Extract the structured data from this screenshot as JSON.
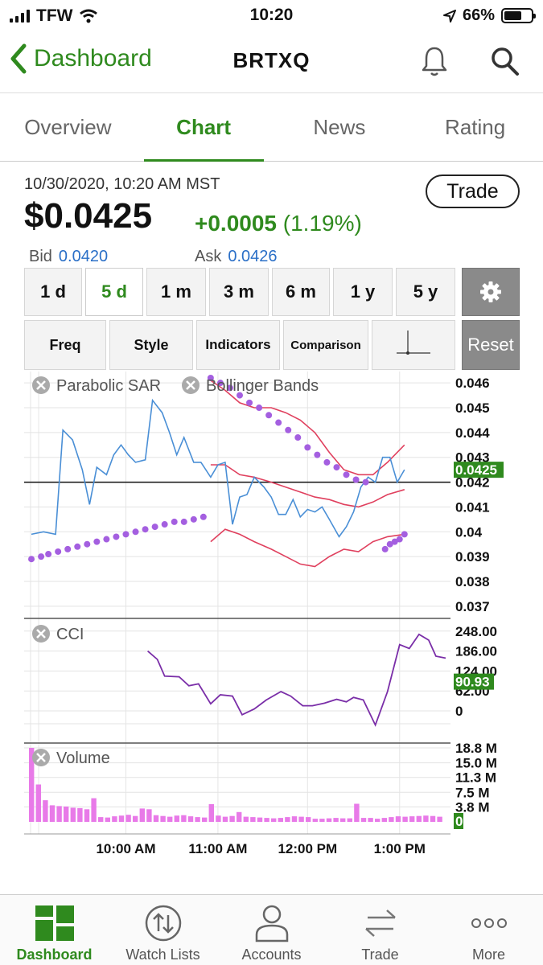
{
  "status_bar": {
    "carrier": "TFW",
    "time": "10:20",
    "battery": "66%"
  },
  "header": {
    "back_label": "Dashboard",
    "title": "BRTXQ"
  },
  "tabs": [
    {
      "label": "Overview",
      "active": false
    },
    {
      "label": "Chart",
      "active": true
    },
    {
      "label": "News",
      "active": false
    },
    {
      "label": "Rating",
      "active": false
    }
  ],
  "quote": {
    "datetime": "10/30/2020, 10:20 AM MST",
    "price": "$0.0425",
    "change": "+0.0005",
    "change_pct": "(1.19%)",
    "bid_label": "Bid",
    "bid": "0.0420",
    "ask_label": "Ask",
    "ask": "0.0426",
    "trade_label": "Trade"
  },
  "ranges": [
    {
      "label": "1 d",
      "selected": false
    },
    {
      "label": "5 d",
      "selected": true
    },
    {
      "label": "1 m",
      "selected": false
    },
    {
      "label": "3 m",
      "selected": false
    },
    {
      "label": "6 m",
      "selected": false
    },
    {
      "label": "1 y",
      "selected": false
    },
    {
      "label": "5 y",
      "selected": false
    }
  ],
  "tools": {
    "freq": "Freq",
    "style": "Style",
    "indicators": "Indicators",
    "comparison": "Comparison",
    "reset": "Reset"
  },
  "colors": {
    "accent": "#2f8a1e",
    "price_line": "#4a8fd6",
    "bands": "#e0405e",
    "sar": "#a45fe0",
    "cci": "#7a2ea8",
    "volume": "#e87ae8"
  },
  "chart_data": {
    "type": "line",
    "x_ticks": [
      "10:00 AM",
      "11:00 AM",
      "12:00 PM",
      "1:00 PM"
    ],
    "price_panel": {
      "legend": [
        "Parabolic SAR",
        "Bollinger Bands"
      ],
      "y_ticks": [
        0.046,
        0.045,
        0.044,
        0.043,
        0.042,
        0.041,
        0.04,
        0.039,
        0.038,
        0.037
      ],
      "ylim": [
        0.0368,
        0.0462
      ],
      "last_label": "0.0425",
      "reference_line": 0.042,
      "price": [
        [
          0.3,
          0.0399
        ],
        [
          0.8,
          0.04
        ],
        [
          1.3,
          0.0399
        ],
        [
          1.6,
          0.0441
        ],
        [
          2.0,
          0.0437
        ],
        [
          2.4,
          0.0425
        ],
        [
          2.7,
          0.0411
        ],
        [
          3.0,
          0.0426
        ],
        [
          3.4,
          0.0423
        ],
        [
          3.7,
          0.0431
        ],
        [
          4.0,
          0.0435
        ],
        [
          4.3,
          0.0431
        ],
        [
          4.6,
          0.0428
        ],
        [
          5.0,
          0.0429
        ],
        [
          5.3,
          0.0453
        ],
        [
          5.7,
          0.0448
        ],
        [
          6.0,
          0.044
        ],
        [
          6.3,
          0.0431
        ],
        [
          6.6,
          0.0438
        ],
        [
          7.0,
          0.0428
        ],
        [
          7.3,
          0.0428
        ],
        [
          7.7,
          0.0422
        ],
        [
          8.0,
          0.0427
        ],
        [
          8.3,
          0.0428
        ],
        [
          8.6,
          0.0403
        ],
        [
          8.9,
          0.0414
        ],
        [
          9.2,
          0.0415
        ],
        [
          9.5,
          0.0422
        ],
        [
          9.9,
          0.0418
        ],
        [
          10.2,
          0.0414
        ],
        [
          10.5,
          0.0407
        ],
        [
          10.8,
          0.0407
        ],
        [
          11.1,
          0.0413
        ],
        [
          11.4,
          0.0406
        ],
        [
          11.7,
          0.0409
        ],
        [
          12.0,
          0.0408
        ],
        [
          12.3,
          0.041
        ],
        [
          12.6,
          0.0405
        ],
        [
          13.0,
          0.0398
        ],
        [
          13.3,
          0.0402
        ],
        [
          13.6,
          0.0408
        ],
        [
          13.9,
          0.0418
        ],
        [
          14.2,
          0.0422
        ],
        [
          14.5,
          0.042
        ],
        [
          14.8,
          0.043
        ],
        [
          15.1,
          0.043
        ],
        [
          15.4,
          0.042
        ],
        [
          15.7,
          0.0425
        ]
      ],
      "upper_band": [
        [
          7.7,
          0.0461
        ],
        [
          8.3,
          0.0457
        ],
        [
          8.9,
          0.0452
        ],
        [
          9.5,
          0.045
        ],
        [
          10.2,
          0.045
        ],
        [
          10.8,
          0.0448
        ],
        [
          11.4,
          0.0445
        ],
        [
          12.0,
          0.044
        ],
        [
          12.6,
          0.0432
        ],
        [
          13.2,
          0.0425
        ],
        [
          13.8,
          0.0423
        ],
        [
          14.4,
          0.0423
        ],
        [
          15.0,
          0.0428
        ],
        [
          15.7,
          0.0435
        ]
      ],
      "middle_band": [
        [
          7.7,
          0.0427
        ],
        [
          8.3,
          0.0427
        ],
        [
          8.9,
          0.0423
        ],
        [
          9.5,
          0.0422
        ],
        [
          10.2,
          0.042
        ],
        [
          10.8,
          0.0418
        ],
        [
          11.4,
          0.0416
        ],
        [
          12.0,
          0.0414
        ],
        [
          12.6,
          0.0413
        ],
        [
          13.2,
          0.0411
        ],
        [
          13.8,
          0.041
        ],
        [
          14.4,
          0.0412
        ],
        [
          15.0,
          0.0415
        ],
        [
          15.7,
          0.0417
        ]
      ],
      "lower_band": [
        [
          7.7,
          0.0396
        ],
        [
          8.3,
          0.0401
        ],
        [
          8.9,
          0.0399
        ],
        [
          9.5,
          0.0396
        ],
        [
          10.2,
          0.0393
        ],
        [
          10.8,
          0.039
        ],
        [
          11.4,
          0.0387
        ],
        [
          12.0,
          0.0386
        ],
        [
          12.6,
          0.039
        ],
        [
          13.2,
          0.0393
        ],
        [
          13.8,
          0.0392
        ],
        [
          14.4,
          0.0396
        ],
        [
          15.0,
          0.0398
        ],
        [
          15.7,
          0.0399
        ]
      ],
      "sar": [
        [
          0.3,
          0.0389
        ],
        [
          0.7,
          0.039
        ],
        [
          1.0,
          0.0391
        ],
        [
          1.4,
          0.0392
        ],
        [
          1.8,
          0.0393
        ],
        [
          2.2,
          0.0394
        ],
        [
          2.6,
          0.0395
        ],
        [
          3.0,
          0.0396
        ],
        [
          3.4,
          0.0397
        ],
        [
          3.8,
          0.0398
        ],
        [
          4.2,
          0.0399
        ],
        [
          4.6,
          0.04
        ],
        [
          5.0,
          0.0401
        ],
        [
          5.4,
          0.0402
        ],
        [
          5.8,
          0.0403
        ],
        [
          6.2,
          0.0404
        ],
        [
          6.6,
          0.0404
        ],
        [
          7.0,
          0.0405
        ],
        [
          7.4,
          0.0406
        ],
        [
          7.7,
          0.0462
        ],
        [
          8.1,
          0.046
        ],
        [
          8.5,
          0.0458
        ],
        [
          8.9,
          0.0455
        ],
        [
          9.3,
          0.0452
        ],
        [
          9.7,
          0.045
        ],
        [
          10.1,
          0.0447
        ],
        [
          10.5,
          0.0444
        ],
        [
          10.9,
          0.0441
        ],
        [
          11.3,
          0.0438
        ],
        [
          11.7,
          0.0434
        ],
        [
          12.1,
          0.0431
        ],
        [
          12.5,
          0.0428
        ],
        [
          12.9,
          0.0426
        ],
        [
          13.3,
          0.0423
        ],
        [
          13.7,
          0.0421
        ],
        [
          14.1,
          0.042
        ],
        [
          14.9,
          0.0393
        ],
        [
          15.1,
          0.0395
        ],
        [
          15.3,
          0.0396
        ],
        [
          15.5,
          0.0397
        ],
        [
          15.7,
          0.0399
        ]
      ]
    },
    "cci_panel": {
      "legend": "CCI",
      "y_ticks": [
        "248.00",
        "186.00",
        "124.00",
        "62.00",
        "0"
      ],
      "last_label": "90.93",
      "values": [
        [
          5.1,
          186
        ],
        [
          5.5,
          160
        ],
        [
          5.8,
          108
        ],
        [
          6.4,
          106
        ],
        [
          6.8,
          78
        ],
        [
          7.2,
          84
        ],
        [
          7.7,
          22
        ],
        [
          8.1,
          50
        ],
        [
          8.6,
          46
        ],
        [
          9.0,
          -12
        ],
        [
          9.5,
          6
        ],
        [
          10.0,
          34
        ],
        [
          10.6,
          60
        ],
        [
          11.0,
          46
        ],
        [
          11.5,
          16
        ],
        [
          11.9,
          16
        ],
        [
          12.4,
          24
        ],
        [
          12.9,
          36
        ],
        [
          13.3,
          28
        ],
        [
          13.6,
          42
        ],
        [
          14.0,
          34
        ],
        [
          14.5,
          -44
        ],
        [
          15.0,
          60
        ],
        [
          15.5,
          206
        ],
        [
          15.9,
          194
        ],
        [
          16.3,
          238
        ],
        [
          16.7,
          220
        ],
        [
          17.0,
          170
        ],
        [
          17.4,
          164
        ]
      ]
    },
    "volume_panel": {
      "legend": "Volume",
      "y_ticks": [
        "18.8 M",
        "15.0 M",
        "11.3 M",
        "7.5 M",
        "3.8 M"
      ],
      "last_label": "0",
      "values": [
        18.8,
        9.5,
        5.5,
        4.2,
        4.0,
        3.9,
        3.6,
        3.5,
        3.2,
        6.0,
        1.2,
        1.1,
        1.4,
        1.6,
        1.8,
        1.5,
        3.4,
        3.2,
        1.7,
        1.5,
        1.3,
        1.6,
        1.7,
        1.4,
        1.2,
        1.1,
        4.5,
        1.6,
        1.3,
        1.5,
        2.5,
        1.3,
        1.2,
        1.1,
        1.0,
        0.9,
        1.0,
        1.2,
        1.4,
        1.3,
        1.2,
        0.8,
        0.8,
        0.9,
        1.0,
        0.9,
        0.9,
        4.6,
        1.0,
        1.0,
        0.8,
        1.0,
        1.2,
        1.4,
        1.3,
        1.4,
        1.5,
        1.6,
        1.5,
        1.3
      ]
    }
  },
  "bottom_tabs": [
    {
      "label": "Dashboard",
      "icon": "grid-icon",
      "active": true
    },
    {
      "label": "Watch Lists",
      "icon": "up-down-arrows-icon",
      "active": false
    },
    {
      "label": "Accounts",
      "icon": "person-icon",
      "active": false
    },
    {
      "label": "Trade",
      "icon": "swap-arrows-icon",
      "active": false
    },
    {
      "label": "More",
      "icon": "dots-icon",
      "active": false
    }
  ]
}
